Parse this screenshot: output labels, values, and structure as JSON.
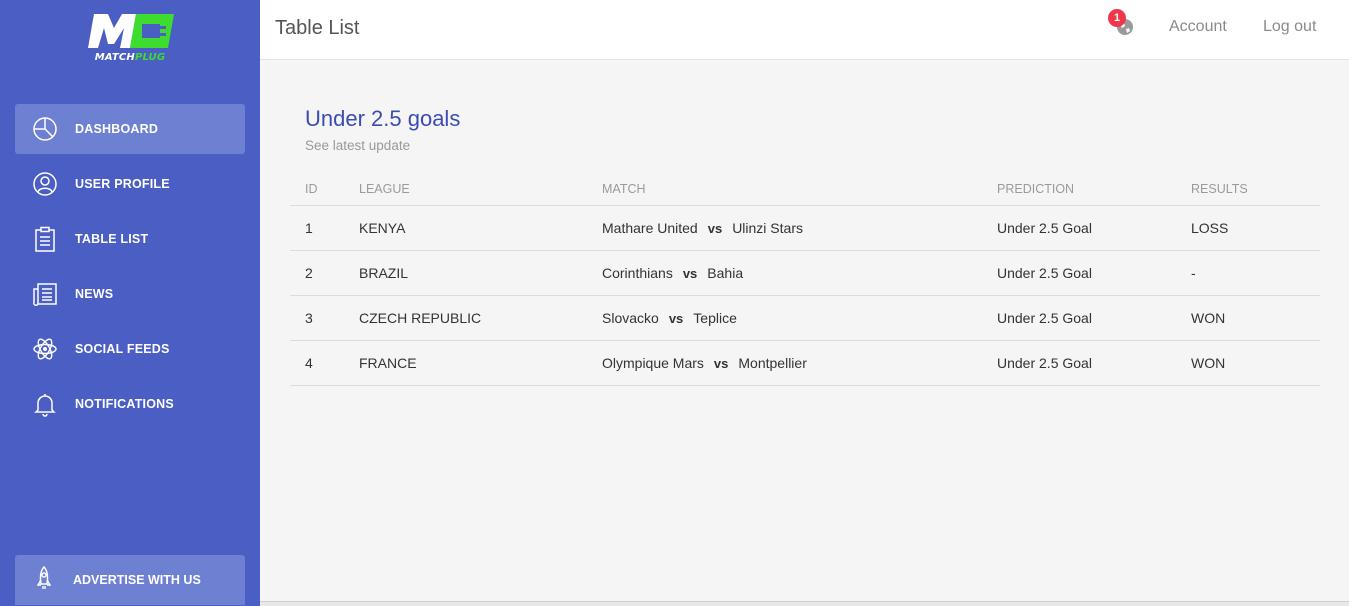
{
  "brand": {
    "logo_mark": "M",
    "name_part1": "MATCH",
    "name_part2": "PLUG",
    "accent": "#3ddc2f",
    "sidebar_color": "#4a5ec4"
  },
  "sidebar": {
    "items": [
      {
        "label": "Dashboard",
        "icon": "pie-chart-icon",
        "active": true
      },
      {
        "label": "User Profile",
        "icon": "user-icon",
        "active": false
      },
      {
        "label": "Table List",
        "icon": "clipboard-icon",
        "active": false
      },
      {
        "label": "News",
        "icon": "newspaper-icon",
        "active": false
      },
      {
        "label": "Social Feeds",
        "icon": "atom-icon",
        "active": false
      },
      {
        "label": "Notifications",
        "icon": "bell-icon",
        "active": false
      }
    ],
    "advertise": {
      "label": "Advertise With Us",
      "icon": "rocket-icon"
    }
  },
  "topbar": {
    "title": "Table List",
    "notification_count": "1",
    "account_label": "Account",
    "logout_label": "Log out"
  },
  "card": {
    "title": "Under 2.5 goals",
    "subtitle": "See latest update"
  },
  "table": {
    "headers": [
      "ID",
      "LEAGUE",
      "MATCH",
      "PREDICTION",
      "RESULTS"
    ],
    "vs_label": "vs",
    "rows": [
      {
        "id": "1",
        "league": "KENYA",
        "home": "Mathare United",
        "away": "Ulinzi Stars",
        "prediction": "Under 2.5 Goal",
        "result": "LOSS"
      },
      {
        "id": "2",
        "league": "BRAZIL",
        "home": "Corinthians",
        "away": "Bahia",
        "prediction": "Under 2.5 Goal",
        "result": "-"
      },
      {
        "id": "3",
        "league": "CZECH REPUBLIC",
        "home": "Slovacko",
        "away": "Teplice",
        "prediction": "Under 2.5 Goal",
        "result": "WON"
      },
      {
        "id": "4",
        "league": "FRANCE",
        "home": "Olympique Mars",
        "away": "Montpellier",
        "prediction": "Under 2.5 Goal",
        "result": "WON"
      }
    ]
  }
}
